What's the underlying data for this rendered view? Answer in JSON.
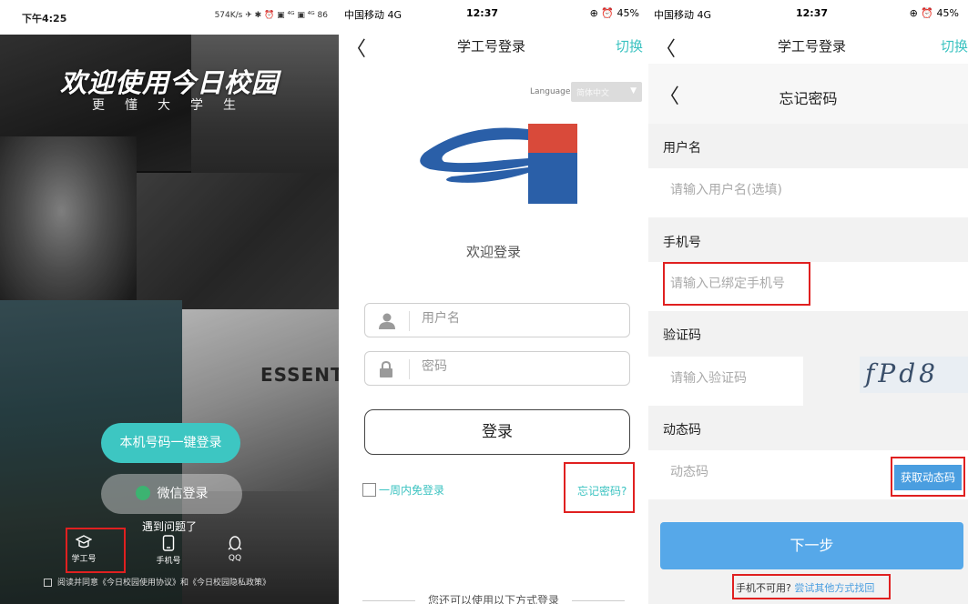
{
  "panel1": {
    "status": {
      "time": "下午4:25",
      "right": "574K/s ✈ ✱ ⏰ ▣ ⁴ᴳ ▣ ⁴ᴳ 86"
    },
    "title": "欢迎使用今日校园",
    "subtitle": "更懂大学生",
    "photo_text": "ESSENTI",
    "btn_mobile": "本机号码一键登录",
    "btn_wechat": "微信登录",
    "problem": "遇到问题了",
    "options": [
      {
        "label": "学工号",
        "icon": "graduation-cap-icon"
      },
      {
        "label": "手机号",
        "icon": "mobile-icon"
      },
      {
        "label": "QQ",
        "icon": "qq-penguin-icon"
      }
    ],
    "agree": "阅读并同意《今日校园使用协议》和《今日校园隐私政策》"
  },
  "panel2": {
    "status": {
      "carrier": "中国移动 4G",
      "time": "12:37",
      "right": "⊕ ⏰ 45%"
    },
    "nav": {
      "back": "〈",
      "title": "学工号登录",
      "switch": "切换"
    },
    "language_label": "Language:",
    "language_value": "简体中文",
    "welcome": "欢迎登录",
    "username_placeholder": "用户名",
    "password_placeholder": "密码",
    "login_btn": "登录",
    "remember": "一周内免登录",
    "forgot": "忘记密码?",
    "other": "您还可以使用以下方式登录"
  },
  "panel3": {
    "status": {
      "carrier": "中国移动 4G",
      "time": "12:37",
      "right": "⊕ ⏰ 45%"
    },
    "nav": {
      "back": "〈",
      "title": "学工号登录",
      "switch": "切换"
    },
    "page_back": "〈",
    "page_title": "忘记密码",
    "label_username": "用户名",
    "username_placeholder": "请输入用户名(选填)",
    "label_phone": "手机号",
    "phone_placeholder": "请输入已绑定手机号",
    "label_captcha": "验证码",
    "captcha_placeholder": "请输入验证码",
    "captcha_text": "fPd8",
    "label_code": "动态码",
    "code_placeholder": "动态码",
    "get_code_btn": "获取动态码",
    "next_btn": "下一步",
    "unavailable": "手机不可用?",
    "unavailable_link": "尝试其他方式找回"
  },
  "colors": {
    "teal": "#3dc6c2",
    "link_teal": "#3cc3c1",
    "blue": "#56a8e9",
    "highlight_red": "#e02020"
  }
}
